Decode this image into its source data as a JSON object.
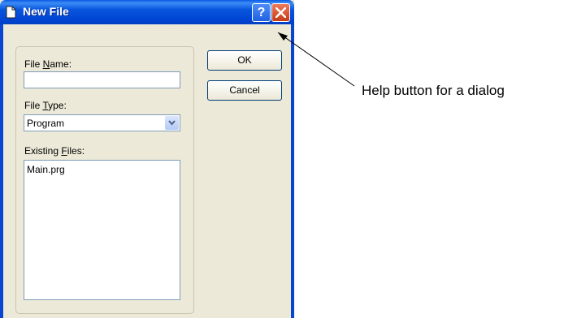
{
  "dialog": {
    "title": "New File",
    "help_button": "?"
  },
  "form": {
    "file_name": {
      "label_prefix": "File ",
      "label_key": "N",
      "label_suffix": "ame:",
      "value": ""
    },
    "file_type": {
      "label_prefix": "File ",
      "label_key": "T",
      "label_suffix": "ype:",
      "selected": "Program"
    },
    "existing_files": {
      "label_prefix": "Existing ",
      "label_key": "F",
      "label_suffix": "iles:",
      "items": [
        "Main.prg"
      ]
    }
  },
  "buttons": {
    "ok": "OK",
    "cancel": "Cancel"
  },
  "annotation": {
    "text": "Help button for a dialog"
  }
}
